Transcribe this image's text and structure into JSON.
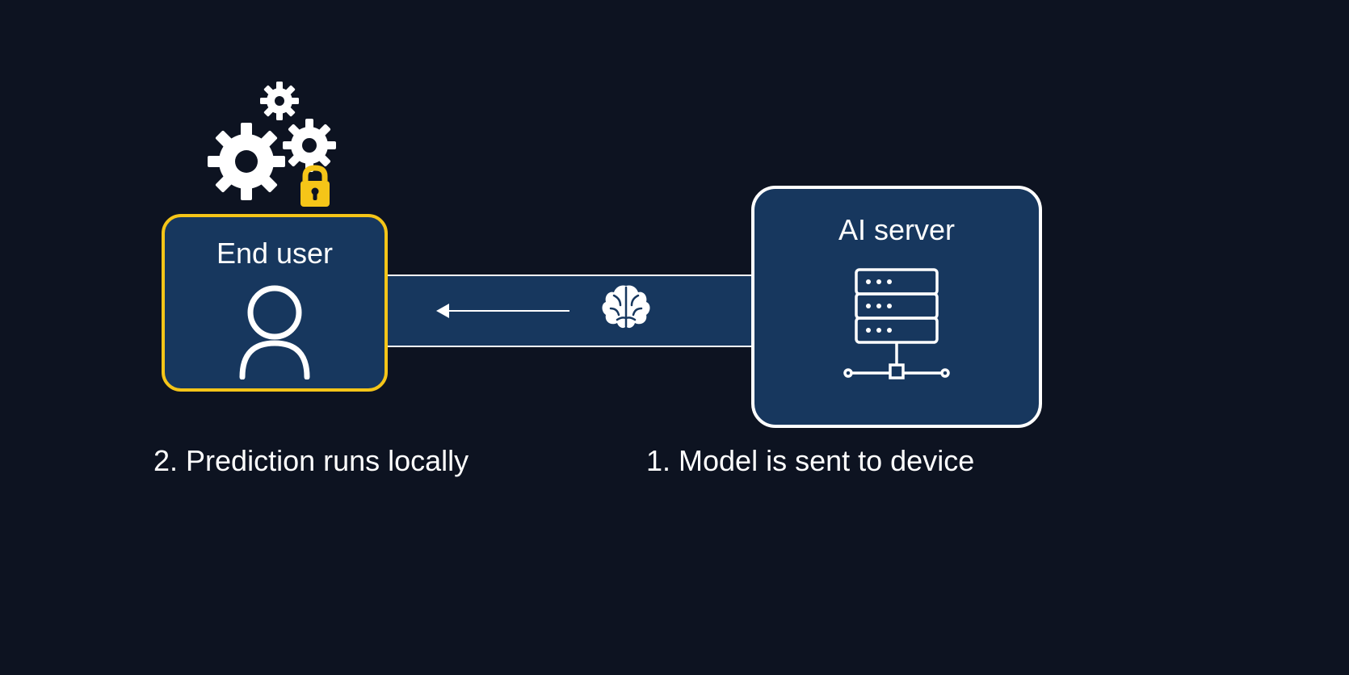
{
  "diagram": {
    "end_user": {
      "label": "End user"
    },
    "ai_server": {
      "label": "AI server"
    },
    "captions": {
      "left": "2. Prediction runs locally",
      "right": "1. Model is sent to device"
    },
    "icons": {
      "gears": "gears-icon",
      "lock": "lock-icon",
      "user": "user-icon",
      "brain": "brain-icon",
      "server": "server-icon",
      "arrow": "arrow-left-icon"
    },
    "colors": {
      "background": "#0d1321",
      "box_fill": "#17375e",
      "highlight_border": "#f5c518",
      "default_border": "#ffffff",
      "lock_fill": "#f5c518"
    }
  }
}
